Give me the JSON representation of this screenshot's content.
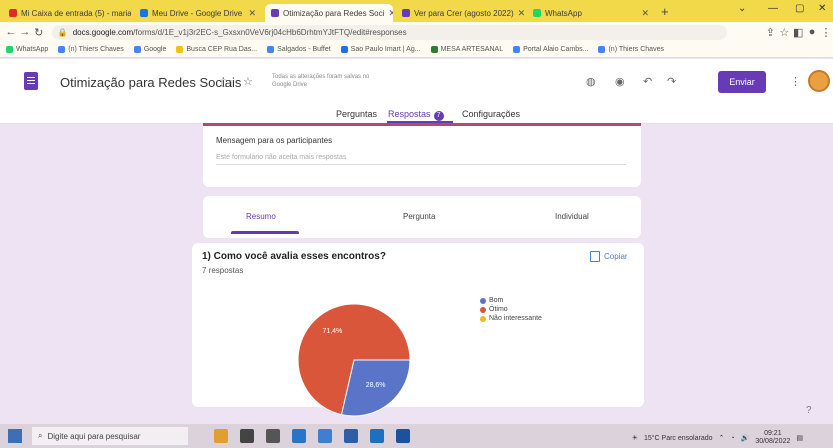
{
  "browser": {
    "tabs": [
      {
        "label": "Mi Caixa de entrada (5) - maria",
        "color": "#d93025",
        "active": false
      },
      {
        "label": "Meu Drive - Google Drive",
        "color": "#1a73e8",
        "active": false
      },
      {
        "label": "Otimização para Redes Soci",
        "color": "#673ab7",
        "active": true
      },
      {
        "label": "Ver para Crer (agosto 2022)",
        "color": "#673ab7",
        "active": false
      },
      {
        "label": "WhatsApp",
        "color": "#25d366",
        "active": false
      }
    ],
    "url_domain": "docs.google.com",
    "url_path": "/forms/d/1E_v1j3r2EC-s_Gxsxn0VeV6rj04cHb6DrhtmYJtFTQ/edit#responses",
    "bookmarks": [
      {
        "label": "WhatsApp",
        "color": "#25d366"
      },
      {
        "label": "(n) Thiers Chaves",
        "color": "#4285f4"
      },
      {
        "label": "Google",
        "color": "#4285f4"
      },
      {
        "label": "Busca CEP Rua Das...",
        "color": "#f4c20d"
      },
      {
        "label": "Salgados - Buffet",
        "color": "#4285f4"
      },
      {
        "label": "Sao Paulo Imart | Ag...",
        "color": "#1a73e8"
      },
      {
        "label": "MESA ARTESANAL",
        "color": "#2e7d32"
      },
      {
        "label": "Portal Alaio Cambs...",
        "color": "#4285f4"
      },
      {
        "label": "(n) Thiers Chaves",
        "color": "#4285f4"
      }
    ]
  },
  "form": {
    "title": "Otimização para Redes Sociais",
    "saved_note": "Todas as alterações foram salvas no Google Drive",
    "send_label": "Enviar",
    "tabs": {
      "questions": "Perguntas",
      "responses": "Respostas",
      "responses_badge": "7",
      "settings": "Configurações"
    },
    "message_label": "Mensagem para os participantes",
    "message_placeholder": "Este formulário não aceita mais respostas",
    "summary_tabs": {
      "summary": "Resumo",
      "question": "Pergunta",
      "individual": "Individual"
    },
    "question": "1) Como você avalia esses encontros?",
    "responses_count": "7 respostas",
    "copy_label": "Copiar"
  },
  "chart_data": {
    "type": "pie",
    "categories": [
      "Bom",
      "Ótimo",
      "Não interessante"
    ],
    "values": [
      28.6,
      71.4,
      0
    ],
    "labels": [
      "28,6%",
      "71,4%",
      ""
    ],
    "colors": [
      "#5a74c8",
      "#d9563a",
      "#f2b62b"
    ]
  },
  "taskbar": {
    "search_placeholder": "Digite aqui para pesquisar",
    "weather": "15°C Parc ensolarado",
    "time": "09:21",
    "date": "30/08/2022"
  }
}
